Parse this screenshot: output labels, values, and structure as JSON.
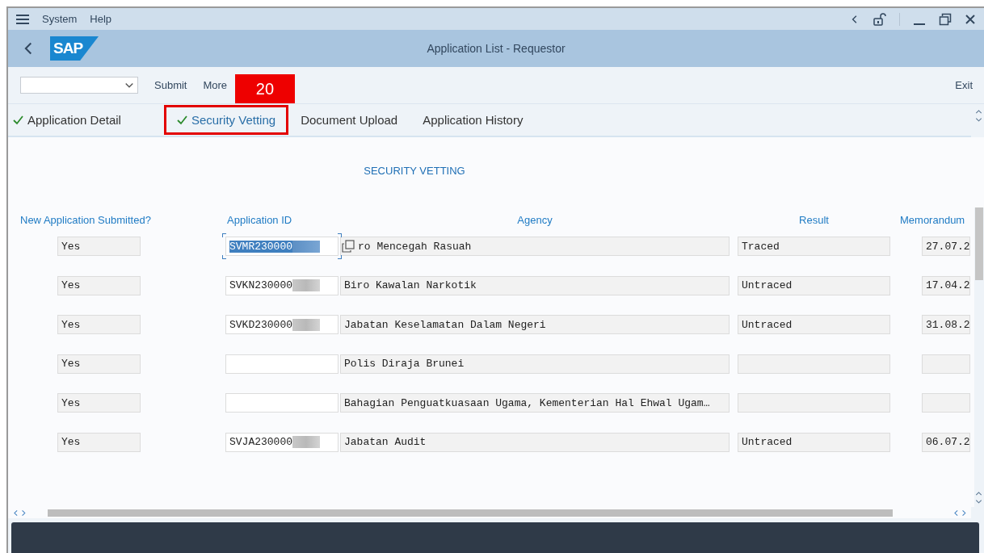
{
  "menu_bar": {
    "items": [
      "System",
      "Help"
    ]
  },
  "header": {
    "logo_text": "SAP",
    "title": "Application List - Requestor"
  },
  "toolbar": {
    "buttons": [
      "Submit",
      "More"
    ],
    "exit": "Exit"
  },
  "tabs": [
    {
      "label": "Application Detail",
      "checked": true,
      "selected": false,
      "highlighted": false
    },
    {
      "label": "Security Vetting",
      "checked": true,
      "selected": true,
      "highlighted": true,
      "callout": "20"
    },
    {
      "label": "Document Upload",
      "checked": false,
      "selected": false,
      "highlighted": false
    },
    {
      "label": "Application History",
      "checked": false,
      "selected": false,
      "highlighted": false
    }
  ],
  "section_title": "SECURITY VETTING",
  "columns": [
    "New Application Submitted?",
    "Application ID",
    "Agency",
    "Result",
    "Memorandum"
  ],
  "rows": [
    {
      "submitted": "Yes",
      "application_id": "SVMR230000",
      "id_redacted": true,
      "focused": true,
      "agency": "ro Mencegah Rasuah",
      "result": "Traced",
      "memorandum_date": "27.07.2"
    },
    {
      "submitted": "Yes",
      "application_id": "SVKN230000",
      "id_redacted": true,
      "focused": false,
      "agency": "Biro Kawalan Narkotik",
      "result": "Untraced",
      "memorandum_date": "17.04.2"
    },
    {
      "submitted": "Yes",
      "application_id": "SVKD230000",
      "id_redacted": true,
      "focused": false,
      "agency": "Jabatan Keselamatan Dalam Negeri",
      "result": "Untraced",
      "memorandum_date": "31.08.2"
    },
    {
      "submitted": "Yes",
      "id_redacted": false,
      "focused": false,
      "agency": "Polis Diraja Brunei"
    },
    {
      "submitted": "Yes",
      "id_redacted": false,
      "focused": false,
      "agency": "Bahagian Penguatkuasaan Ugama, Kementerian Hal Ehwal Ugam…"
    },
    {
      "submitted": "Yes",
      "application_id": "SVJA230000",
      "id_redacted": true,
      "focused": false,
      "agency": "Jabatan Audit",
      "result": "Untraced",
      "memorandum_date": "06.07.2"
    }
  ]
}
